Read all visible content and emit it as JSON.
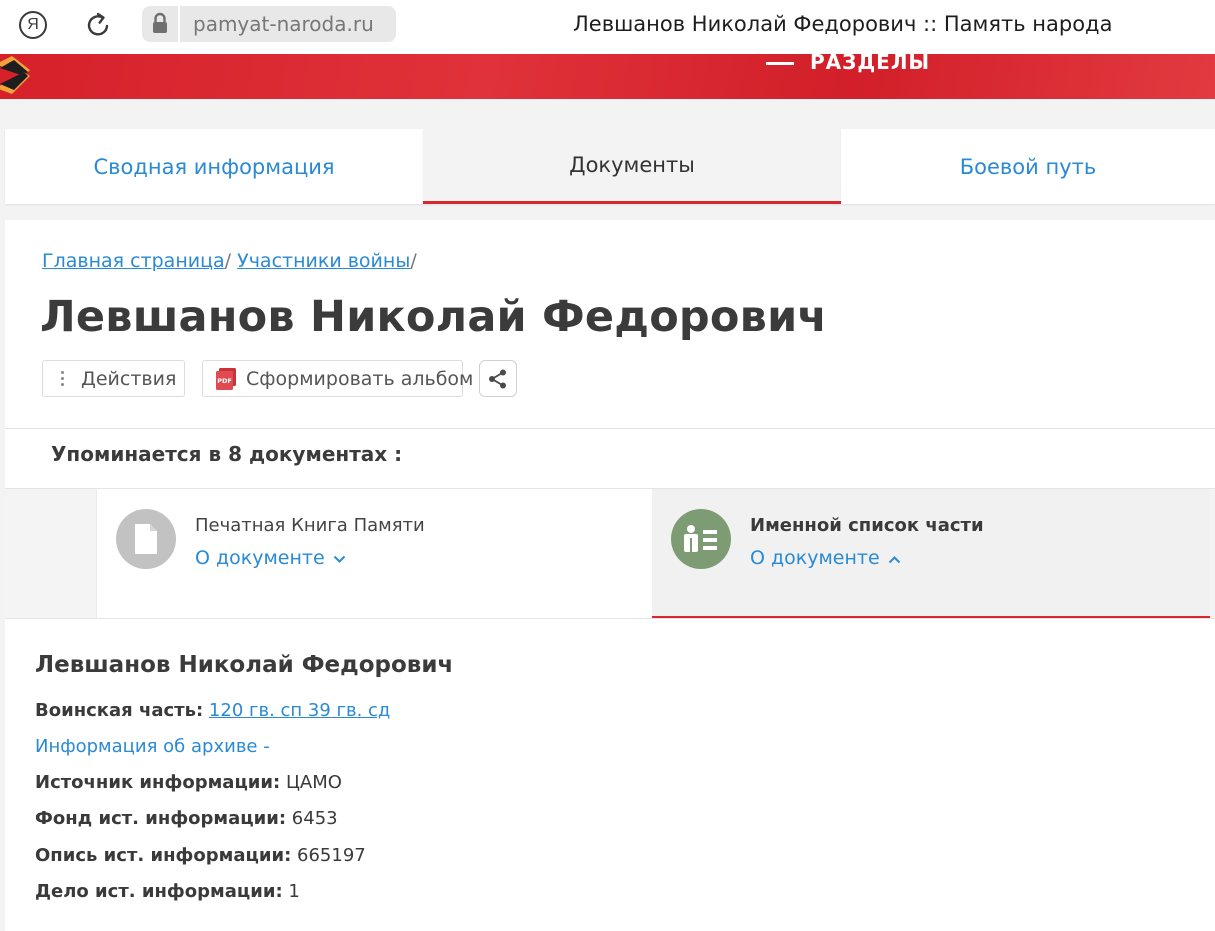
{
  "browser": {
    "logo_glyph": "Я",
    "url": "pamyat-naroda.ru",
    "page_title": "Левшанов Николай Федорович :: Память народа"
  },
  "banner": {
    "menu_label": "РАЗДЕЛЫ",
    "color": "#d6202a"
  },
  "tabs": [
    {
      "label": "Сводная информация",
      "active": false
    },
    {
      "label": "Документы",
      "active": true
    },
    {
      "label": "Боевой путь",
      "active": false
    }
  ],
  "breadcrumb": {
    "items": [
      "Главная страница",
      "Участники войны"
    ],
    "separator": "/"
  },
  "person": {
    "name": "Левшанов Николай Федорович"
  },
  "actions": {
    "actions_label": "Действия",
    "album_label": "Сформировать альбом",
    "pdf_badge": "PDF"
  },
  "mentions_label": "Упоминается в 8 документах :",
  "documents": [
    {
      "name": "Печатная Книга Памяти",
      "link": "О документе",
      "chevron": "down",
      "icon": "document-icon"
    },
    {
      "name": "Именной список части",
      "link": "О документе",
      "chevron": "up",
      "icon": "name-list-icon"
    }
  ],
  "details": {
    "name": "Левшанов Николай Федорович",
    "unit_label": "Воинская часть:",
    "unit_value": "120 гв. сп 39 гв. сд",
    "archive_link": "Информация об архиве -",
    "source_label": "Источник информации:",
    "source_value": "ЦАМО",
    "fund_label": "Фонд ист. информации:",
    "fund_value": "6453",
    "inventory_label": "Опись ист. информации:",
    "inventory_value": "665197",
    "case_label": "Дело ист. информации:",
    "case_value": "1"
  },
  "colors": {
    "accent": "#2a8ad4",
    "active_underline": "#d8282f",
    "doc_icon_grey": "#c2c2c2",
    "doc_icon_green": "#7e9c73"
  }
}
